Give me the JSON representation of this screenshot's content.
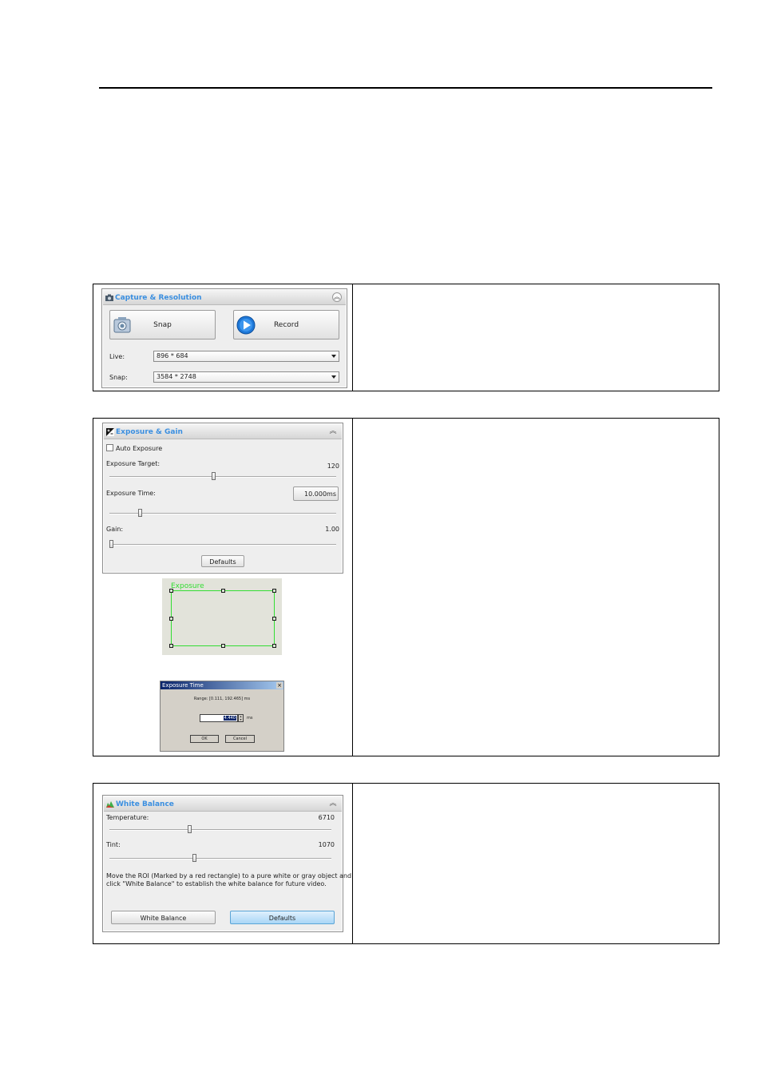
{
  "capture": {
    "title": "Capture & Resolution",
    "snap_label": "Snap",
    "record_label": "Record",
    "live_label": "Live:",
    "live_value": "896 * 684",
    "snap_res_label": "Snap:",
    "snap_res_value": "3584 * 2748",
    "icon": "camera-icon",
    "collapse_icon": "double-chevron-up-icon"
  },
  "exposure": {
    "title": "Exposure & Gain",
    "auto_label": "Auto Exposure",
    "target_label": "Exposure Target:",
    "target_value": "120",
    "time_label": "Exposure Time:",
    "time_value": "10.000ms",
    "gain_label": "Gain:",
    "gain_value": "1.00",
    "defaults_label": "Defaults",
    "target_level": 0.46,
    "time_level": 0.13,
    "gain_level": 0.0
  },
  "roi": {
    "label": "Exposure",
    "color": "#33dd33"
  },
  "exposure_dialog": {
    "title": "Exposure Time",
    "range_text": "Range: [0.111, 192.465] ms",
    "value": "4.440",
    "unit": "ms",
    "ok_label": "OK",
    "cancel_label": "Cancel"
  },
  "white_balance": {
    "title": "White Balance",
    "temp_label": "Temperature:",
    "temp_value": "6710",
    "tint_label": "Tint:",
    "tint_value": "1070",
    "help_line1": "Move the ROI (Marked by a red rectangle) to a pure white or gray object and",
    "help_line2": "click \"White Balance\" to establish the white balance for future video.",
    "wb_button_label": "White Balance",
    "defaults_label": "Defaults",
    "temp_level": 0.36,
    "tint_level": 0.38
  },
  "colors": {
    "accent": "#3b8fe0",
    "panel_bg": "#eeeeee",
    "selected_button": "#a9d6f6"
  }
}
